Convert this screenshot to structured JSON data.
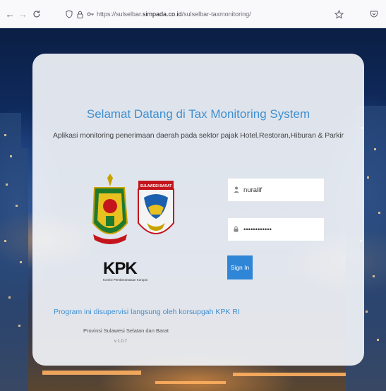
{
  "browser": {
    "url_path_prefix": "https://sulselbar.",
    "url_host": "simpada.co.id",
    "url_path_suffix": "/sulselbar-taxmonitoring/",
    "icons": [
      "back-icon",
      "forward-icon",
      "reload-icon",
      "shield-icon",
      "lock-icon",
      "permissions-icon",
      "star-icon",
      "pocket-icon"
    ]
  },
  "login": {
    "title": "Selamat Datang di Tax Monitoring System",
    "subtitle": "Aplikasi monitoring penerimaan daerah pada sektor pajak Hotel,Restoran,Hiburan & Parkir",
    "username_value": "nuralif",
    "password_value": "••••••••••••",
    "signin_label": "Sign In",
    "kpk_logo": "KPK",
    "kpk_subtitle": "Komisi Pemberantasan Korupsi",
    "seal_label": "SULAWESI BARAT",
    "program_text": "Program ini disupervisi langsung oleh korsupgah KPK RI",
    "province_text": "Provinsi Sulawesi Selatan dan Barat",
    "version": "v 1.0.7"
  },
  "colors": {
    "accent": "#3f8fd0",
    "button": "#2f86d6",
    "kpk_red": "#c4151c"
  }
}
